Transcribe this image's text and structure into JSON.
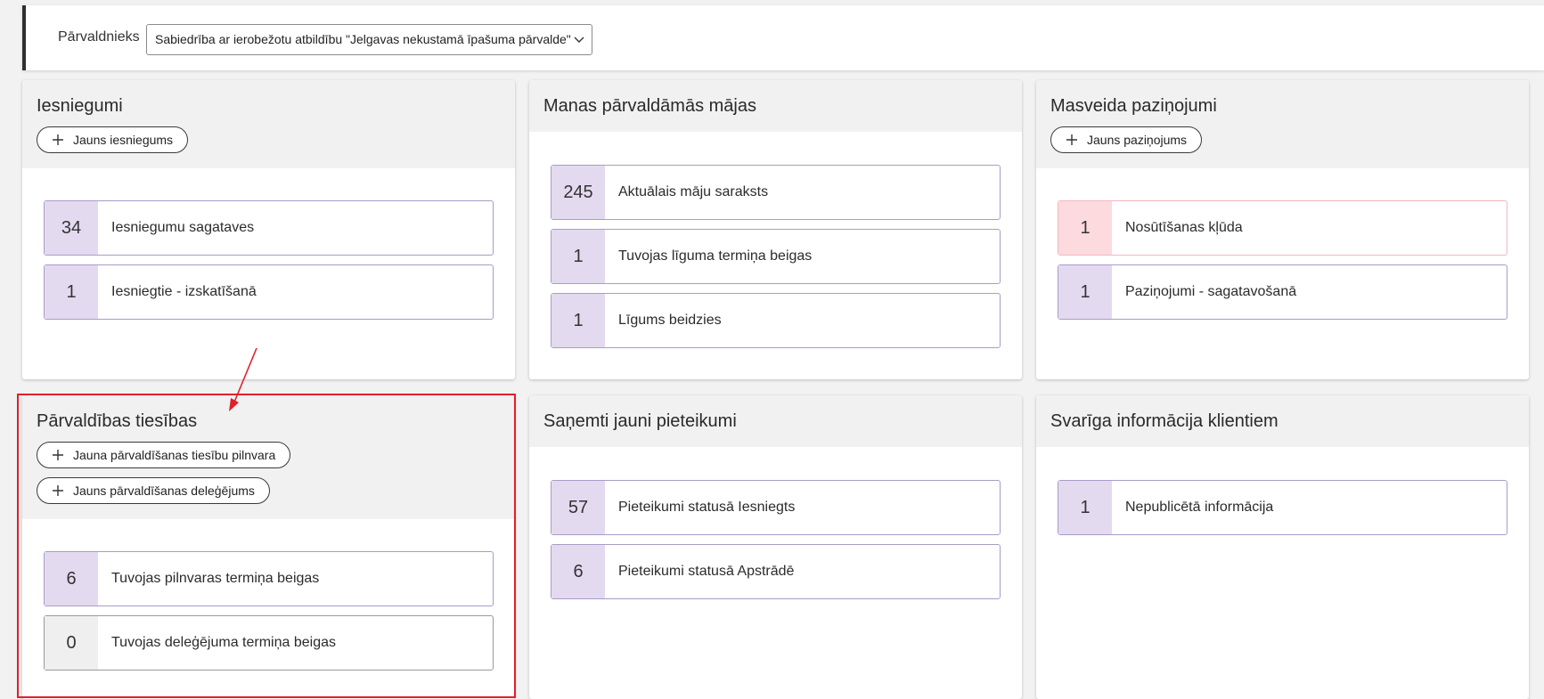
{
  "header": {
    "manager_label": "Pārvaldnieks",
    "manager_value": "Sabiedrība ar ierobežotu atbildību \"Jelgavas nekustamā īpašuma pārvalde\""
  },
  "cards": {
    "submissions": {
      "title": "Iesniegumi",
      "new_button": "Jauns iesniegums",
      "stats": [
        {
          "value": "34",
          "label": "Iesniegumu sagataves"
        },
        {
          "value": "1",
          "label": "Iesniegtie - izskatīšanā"
        }
      ]
    },
    "houses": {
      "title": "Manas pārvaldāmās mājas",
      "stats": [
        {
          "value": "245",
          "label": "Aktuālais māju saraksts"
        },
        {
          "value": "1",
          "label": "Tuvojas līguma termiņa beigas"
        },
        {
          "value": "1",
          "label": "Līgums beidzies"
        }
      ]
    },
    "mass_notices": {
      "title": "Masveida paziņojumi",
      "new_button": "Jauns paziņojums",
      "stats": [
        {
          "value": "1",
          "label": "Nosūtīšanas kļūda"
        },
        {
          "value": "1",
          "label": "Paziņojumi - sagatavošanā"
        }
      ]
    },
    "rights": {
      "title": "Pārvaldības tiesības",
      "new_poa_button": "Jauna pārvaldīšanas tiesību pilnvara",
      "new_delegation_button": "Jauns pārvaldīšanas deleģējums",
      "stats": [
        {
          "value": "6",
          "label": "Tuvojas pilnvaras termiņa beigas"
        },
        {
          "value": "0",
          "label": "Tuvojas deleģējuma termiņa beigas"
        }
      ]
    },
    "applications": {
      "title": "Saņemti jauni pieteikumi",
      "stats": [
        {
          "value": "57",
          "label": "Pieteikumi statusā Iesniegts"
        },
        {
          "value": "6",
          "label": "Pieteikumi statusā Apstrādē"
        }
      ]
    },
    "important_info": {
      "title": "Svarīga informācija klientiem",
      "stats": [
        {
          "value": "1",
          "label": "Nepublicētā informācija"
        }
      ]
    }
  },
  "colors": {
    "accent_purple": "#e4daf0",
    "error_pink": "#fcdadd",
    "highlight_red": "#e0202a"
  }
}
